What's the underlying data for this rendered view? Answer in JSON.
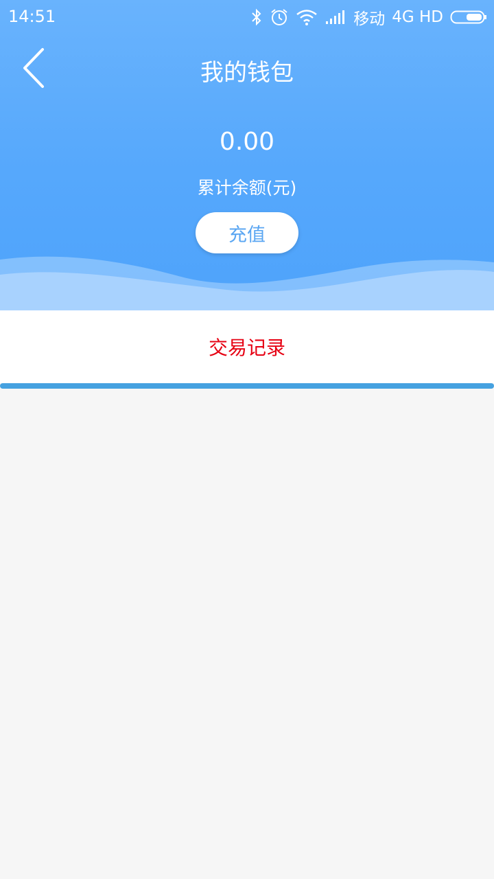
{
  "status_bar": {
    "time": "14:51",
    "carrier": "移动",
    "network": "4G HD",
    "icons": [
      "bluetooth-icon",
      "alarm-icon",
      "wifi-icon",
      "signal-icon",
      "battery-icon"
    ]
  },
  "header": {
    "title": "我的钱包",
    "back_icon": "chevron-left-icon"
  },
  "wallet": {
    "balance": "0.00",
    "balance_label": "累计余额(元)",
    "recharge_label": "充值"
  },
  "tabs": [
    {
      "label": "交易记录",
      "active": true
    }
  ],
  "colors": {
    "primary": "#56a8fc",
    "tab_active_text": "#e60012",
    "indicator": "#45a1e0",
    "background": "#f6f6f6"
  }
}
